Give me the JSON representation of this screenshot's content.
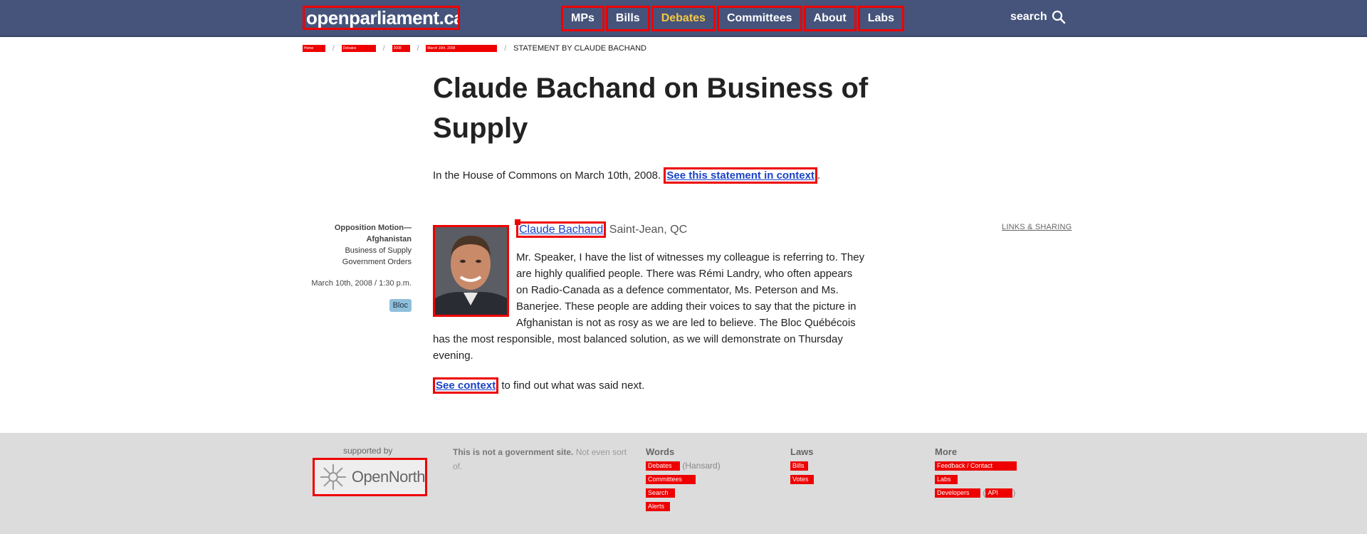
{
  "header": {
    "logo_text": "openparliament.ca",
    "nav": [
      "MPs",
      "Bills",
      "Debates",
      "Committees",
      "About",
      "Labs"
    ],
    "active_nav": "Debates",
    "search_label": "search"
  },
  "breadcrumbs": {
    "links": [
      "Home",
      "Debates",
      "2008",
      "March 10th, 2008",
      ""
    ],
    "current": "STATEMENT BY CLAUDE BACHAND"
  },
  "page": {
    "title": "Claude Bachand on Business of Supply",
    "intro_prefix": "In the House of Commons on March 10th, 2008.",
    "intro_link": "See this statement in context",
    "intro_suffix": "."
  },
  "sidebar": {
    "topic": "Opposition Motion—Afghanistan",
    "subtopic1": "Business of Supply",
    "subtopic2": "Government Orders",
    "date": "March 10th, 2008 / 1:30 p.m.",
    "party": "Bloc"
  },
  "statement": {
    "speaker_name": "Claude Bachand",
    "riding": "Saint-Jean, QC",
    "links_sharing": "LINKS & SHARING",
    "text": "Mr. Speaker, I have the list of witnesses my colleague is referring to. They are highly qualified people. There was Rémi Landry, who often appears on Radio-Canada as a defence commentator, Ms. Peterson and Ms. Banerjee. These people are adding their voices to say that the picture in Afghanistan is not as rosy as we are led to believe. The Bloc Québécois has the most responsible, most balanced solution, as we will demonstrate on Thursday evening.",
    "context_link": "See context",
    "context_suffix": "to find out what was said next."
  },
  "footer": {
    "supported_by": "supported by",
    "opennorth": "OpenNorth",
    "notgov_bold": "This is not a government site.",
    "notgov_rest": "Not even sort of.",
    "words": {
      "heading": "Words",
      "links": [
        "Debates",
        "Committees",
        "Search",
        "Alerts"
      ],
      "hansard": "(Hansard)"
    },
    "laws": {
      "heading": "Laws",
      "links": [
        "Bills",
        "Votes"
      ]
    },
    "more": {
      "heading": "More",
      "links": [
        "Feedback / Contact",
        "Labs",
        "Developers"
      ],
      "api": "API"
    }
  },
  "colors": {
    "header_bg": "#46547b",
    "active_nav": "#f5c842",
    "link": "#1a44c7",
    "footer_bg": "#dcdcdc",
    "party_badge": "#8fbfdb"
  }
}
